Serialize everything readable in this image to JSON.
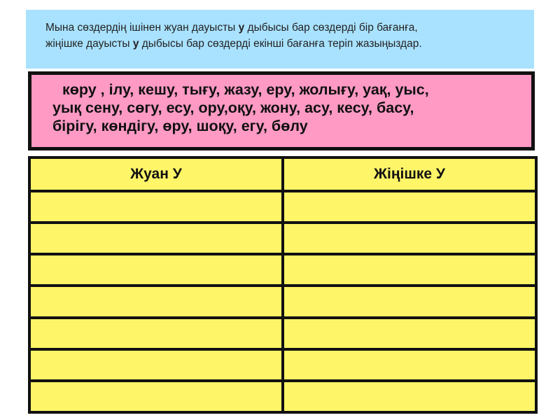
{
  "instruction": {
    "line1_a": "Мына сөздердің ішінен жуан дауысты ",
    "line1_bold": "у",
    "line1_b": " дыбысы бар сөздерді бір бағанға,",
    "line2_a": "жіңішке дауысты ",
    "line2_bold": "у",
    "line2_b": " дыбысы бар сөздерді екінші бағанға теріп жазыңыздар."
  },
  "words": {
    "line1": "көру , ілу, кешу, тығу, жазу, еру, жолығу, уақ, уыс,",
    "line2": "уық сену, сөгу, есу, ору,оқу, жону, асу, кесу, басу,",
    "line3": "бірігу, көндігу, өру, шоқу, егу, бөлу"
  },
  "table": {
    "col1_header": "Жуан  У",
    "col2_header": "Жіңішке У",
    "empty_rows": 7
  },
  "colors": {
    "instruction_bg": "#a9e2ff",
    "words_bg": "#ff9ac4",
    "table_bg": "#fff568",
    "border": "#111111"
  }
}
